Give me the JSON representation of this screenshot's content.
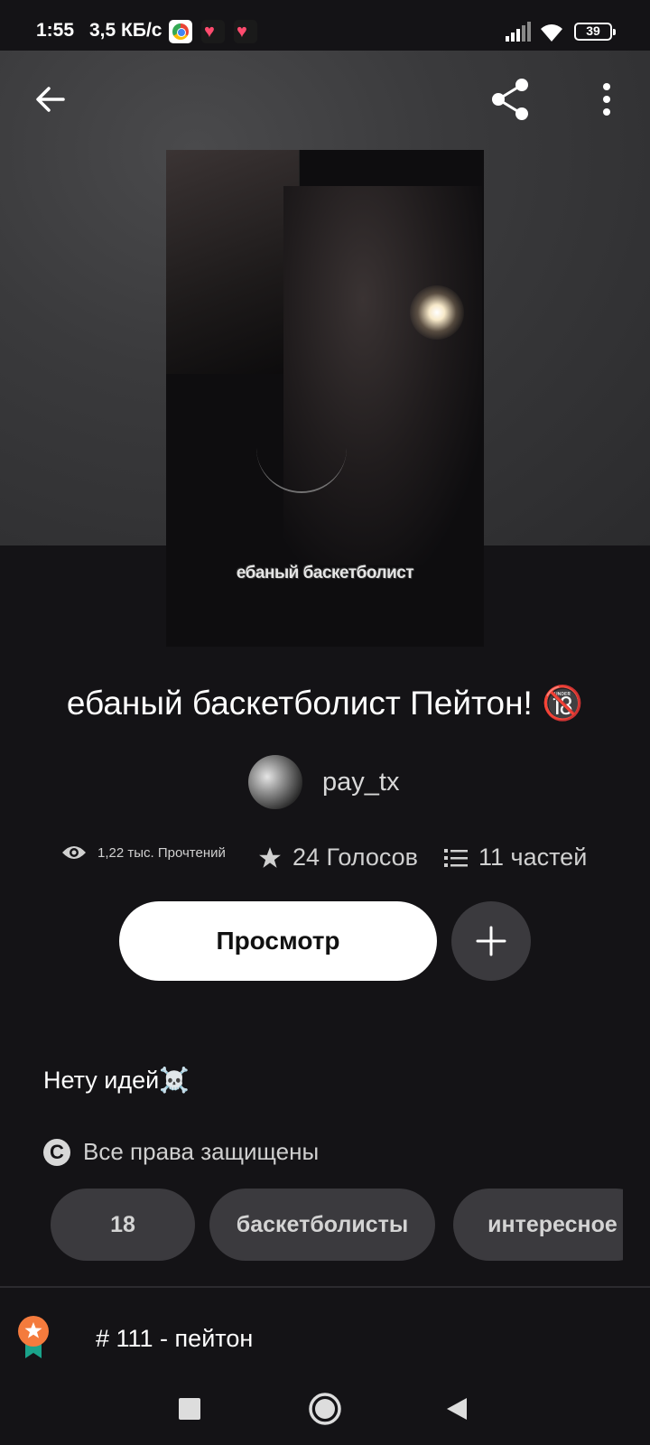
{
  "status_bar": {
    "time": "1:55",
    "net_speed": "3,5 КБ/с",
    "battery": "39",
    "app_icons": [
      "chrome-icon",
      "heart-app-icon",
      "heart-app-icon"
    ]
  },
  "toolbar": {
    "back_icon": "arrow-left-icon",
    "share_icon": "share-icon",
    "more_icon": "more-vertical-icon"
  },
  "cover": {
    "caption": "ебаный баскетболист"
  },
  "story": {
    "title": "ебаный баскетболист Пейтон! 🔞",
    "author": "pay_tx",
    "reads": "1,22 тыс. Прочтений",
    "votes": "24 Голосов",
    "parts": "11 частей",
    "read_button": "Просмотр",
    "description": "Нету идей☠️",
    "copyright": "Все права защищены",
    "copyright_symbol": "C",
    "tags": [
      "18",
      "баскетболисты",
      "интересное"
    ],
    "ranking": "# 111 - пейтон"
  },
  "colors": {
    "background": "#141316",
    "pill": "#3b3a3e",
    "accent_badge": "#f47b3d"
  }
}
